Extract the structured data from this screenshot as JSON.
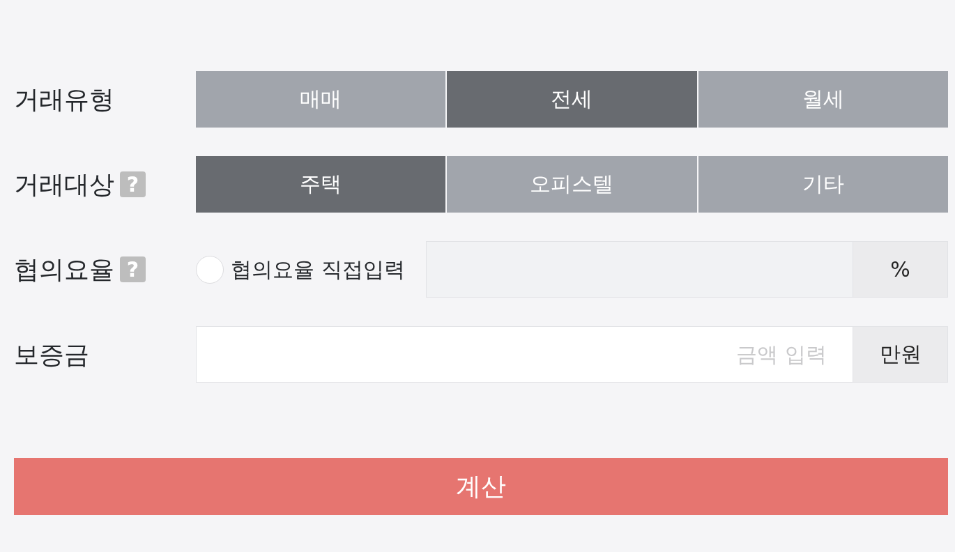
{
  "rows": [
    {
      "kind": "segments",
      "label": "거래유형",
      "options": [
        {
          "label": "매매",
          "selected": false
        },
        {
          "label": "전세",
          "selected": true
        },
        {
          "label": "월세",
          "selected": false
        }
      ]
    },
    {
      "kind": "segments",
      "label": "거래대상",
      "help": "?",
      "options": [
        {
          "label": "주택",
          "selected": true
        },
        {
          "label": "오피스텔",
          "selected": false
        },
        {
          "label": "기타",
          "selected": false
        }
      ]
    },
    {
      "kind": "rate",
      "label": "협의요율",
      "help": "?",
      "radio": {
        "label": "협의요율 직접입력",
        "checked": false
      },
      "input": {
        "disabled": true
      },
      "unit": "%"
    },
    {
      "kind": "amount",
      "label": "보증금",
      "input": {
        "placeholder": "금액 입력"
      },
      "unit": "만원"
    }
  ],
  "submit": {
    "label": "계산"
  }
}
